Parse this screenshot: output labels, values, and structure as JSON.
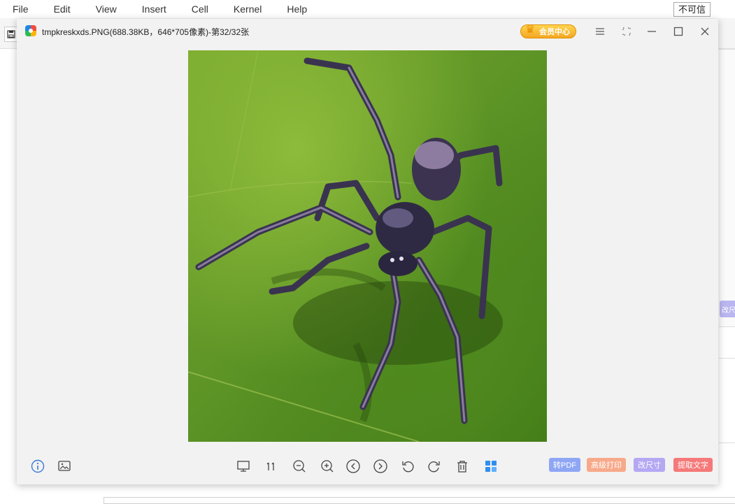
{
  "menubar": {
    "items": [
      "File",
      "Edit",
      "View",
      "Insert",
      "Cell",
      "Kernel",
      "Help"
    ],
    "trust_label": "不可信"
  },
  "background": {
    "resize_tab_label": "改尺"
  },
  "viewer": {
    "title": "tmpkreskxds.PNG(688.38KB，646*705像素)-第32/32张",
    "vip_label": "会员中心",
    "icons": {
      "app": "image-viewer-app-icon",
      "menu": "hamburger-menu-icon",
      "fullscreen": "fullscreen-icon",
      "minimize": "minimize-icon",
      "maximize": "maximize-icon",
      "close": "close-icon"
    },
    "actions": {
      "to_pdf": "转PDF",
      "print": "高级打印",
      "resize": "改尺寸",
      "ocr": "提取文字"
    },
    "action_colors": {
      "to_pdf": "#8fa6f5",
      "print": "#f7a98a",
      "resize": "#b5a8f3",
      "ocr": "#f57979"
    }
  }
}
